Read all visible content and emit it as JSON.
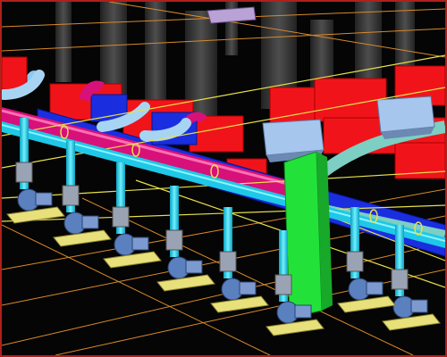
{
  "scene": {
    "kind": "3d-mep-pipe-model-render",
    "frame_color": "#b0201c",
    "background_color": "#050505"
  },
  "palette": {
    "red_duct": "#f0141a",
    "blue_duct": "#1a2ee0",
    "cyan_pipe": "#1ec8e6",
    "light_blue_pipe": "#8fc8f0",
    "magenta_pipe": "#d8107a",
    "teal_pipe": "#7ccfc2",
    "green_riser": "#22e23a",
    "yellow_grid": "#e6e04a",
    "orange_line": "#d98a2a",
    "pump_blue": "#5a80c0",
    "pump_gray": "#9aa3b3",
    "skid_yellow": "#e8e07a",
    "ahu_box": "#a6c6ee",
    "ghost_gray": "#6a6a6a"
  },
  "icons": {
    "pump": "centrifugal-pump-icon",
    "valve": "valve-icon",
    "skid": "equipment-skid-icon",
    "air_handler": "air-handler-box-icon"
  }
}
